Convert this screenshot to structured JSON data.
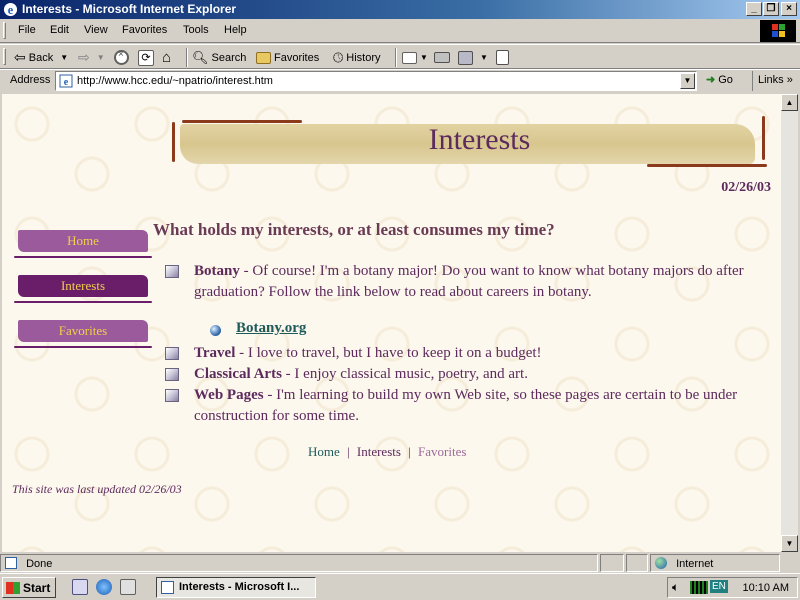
{
  "window": {
    "title": "Interests - Microsoft Internet Explorer"
  },
  "menu": [
    "File",
    "Edit",
    "View",
    "Favorites",
    "Tools",
    "Help"
  ],
  "toolbar": {
    "back": "Back",
    "search": "Search",
    "favorites": "Favorites",
    "history": "History"
  },
  "address": {
    "label": "Address",
    "url": "http://www.hcc.edu/~npatrio/interest.htm",
    "go": "Go",
    "links": "Links"
  },
  "page": {
    "banner_title": "Interests",
    "date": "02/26/03",
    "heading": "What holds my interests, or at least consumes my time?",
    "nav": [
      {
        "label": "Home"
      },
      {
        "label": "Interests"
      },
      {
        "label": "Favorites"
      }
    ],
    "items": [
      {
        "title": "Botany",
        "desc": " - Of course! I'm a botany major! Do you want to know what botany majors do after graduation? Follow the link below to read about careers in botany."
      },
      {
        "title": "Travel",
        "desc": " - I love to travel, but I have to keep it on a budget!"
      },
      {
        "title": "Classical Arts",
        "desc": " - I enjoy classical music, poetry, and art."
      },
      {
        "title": "Web Pages",
        "desc": " - I'm learning to build my own Web site, so these pages are certain to be under construction for some time."
      }
    ],
    "sublink": "Botany.org",
    "footer_nav": {
      "home": "Home",
      "sep1": "|",
      "interests": "Interests",
      "sep2": "|",
      "favorites": "Favorites"
    },
    "updated": "This site was last updated 02/26/03"
  },
  "status": {
    "text": "Done",
    "zone": "Internet"
  },
  "taskbar": {
    "start": "Start",
    "task": "Interests - Microsoft I...",
    "lang": "EN",
    "clock": "10:10 AM"
  },
  "colors": {
    "accent_purple": "#5c2a5c",
    "nav_light": "#9b5a9b",
    "nav_dark": "#6a1e6a",
    "nav_text": "#f0d048",
    "link": "#1e5a5a"
  }
}
